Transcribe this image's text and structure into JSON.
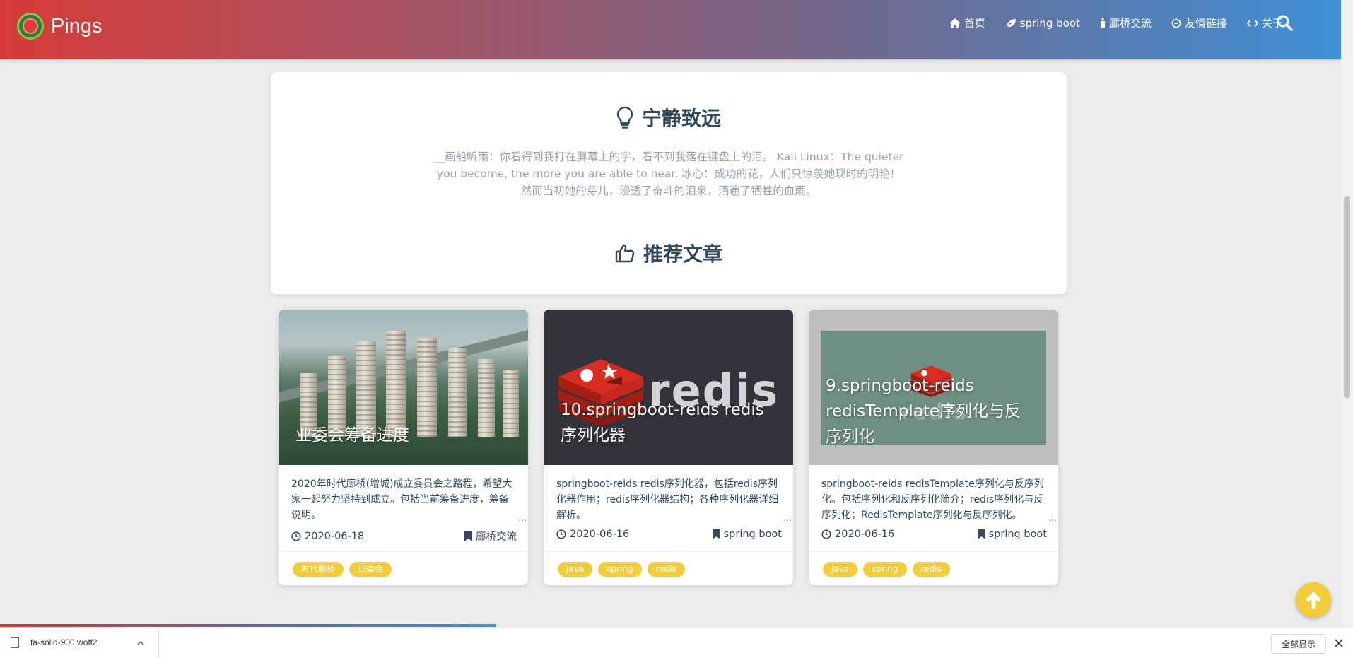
{
  "nav": {
    "brand": "Pings",
    "items": [
      {
        "label": "首页",
        "icon": "home-icon"
      },
      {
        "label": "spring boot",
        "icon": "leaf-icon"
      },
      {
        "label": "廊桥交流",
        "icon": "bottle-icon"
      },
      {
        "label": "友情链接",
        "icon": "link-icon"
      },
      {
        "label": "关于",
        "icon": "code-icon"
      }
    ]
  },
  "hero": {
    "title": "宁静致远",
    "text": "__画船听雨：你看得到我打在屏幕上的字，看不到我落在键盘上的泪。 Kali Linux：The quieter you become, the more you are able to hear. 冰心：成功的花，人们只惊羡她现时的明艳！然而当初她的芽儿，浸透了奋斗的泪泉，洒遍了牺牲的血雨。",
    "section_title": "推荐文章"
  },
  "articles": [
    {
      "title": "业委会筹备进度",
      "desc": "2020年时代廊桥(增城)成立委员会之路程，希望大家一起努力坚持到成立。包括当前筹备进度，筹备说明。",
      "date": "2020-06-18",
      "category": "廊桥交流",
      "tags": [
        "时代廊桥",
        "业委会"
      ]
    },
    {
      "title": "10.springboot-reids redis序列化器",
      "desc": "springboot-reids redis序列化器，包括redis序列化器作用；redis序列化器结构；各种序列化器详细解析。",
      "date": "2020-06-16",
      "category": "spring boot",
      "tags": [
        "java",
        "spring",
        "redis"
      ]
    },
    {
      "title": "9.springboot-reids redisTemplate序列化与反序列化",
      "desc": "springboot-reids redisTemplate序列化与反序列化。包括序列化和反序列化简介；redis序列化与反序列化；RedisTemplate序列化与反序列化。",
      "date": "2020-06-16",
      "category": "spring boot",
      "tags": [
        "java",
        "spring",
        "redis"
      ]
    }
  ],
  "card_ellipsis": "...",
  "redis_word": "redis",
  "read_progress": 0.37,
  "download": {
    "filename": "fa-solid-900.woff2",
    "show_all": "全部显示"
  },
  "colors": {
    "accent_yellow": "#f2cc3a",
    "nav_left": "#d63b39",
    "nav_right": "#3f8fd6",
    "heading": "#34495e"
  }
}
